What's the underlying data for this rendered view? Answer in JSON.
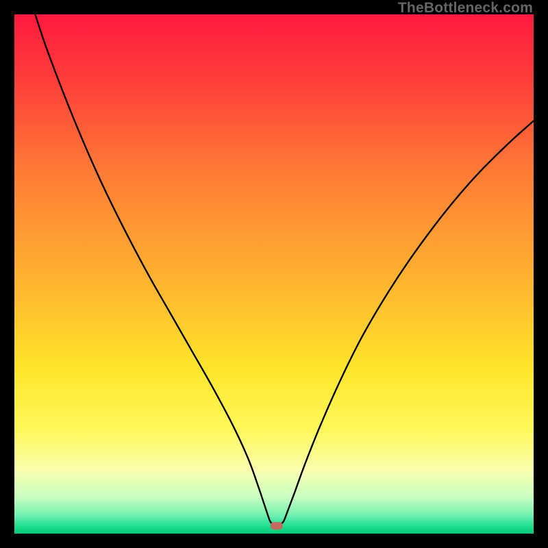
{
  "watermark": "TheBottleneck.com",
  "chart_data": {
    "type": "line",
    "title": "",
    "xlabel": "",
    "ylabel": "",
    "xlim": [
      0,
      100
    ],
    "ylim": [
      0,
      100
    ],
    "marker": {
      "x": 50.5,
      "y": 1.5,
      "color": "#c46a5f"
    },
    "background_gradient": {
      "stops": [
        {
          "offset": 0.0,
          "color": "#ff1a3f"
        },
        {
          "offset": 0.12,
          "color": "#ff3b3a"
        },
        {
          "offset": 0.3,
          "color": "#ff7a35"
        },
        {
          "offset": 0.5,
          "color": "#ffb030"
        },
        {
          "offset": 0.68,
          "color": "#ffe42a"
        },
        {
          "offset": 0.8,
          "color": "#fff85a"
        },
        {
          "offset": 0.88,
          "color": "#f7ffb0"
        },
        {
          "offset": 0.93,
          "color": "#c8ffc0"
        },
        {
          "offset": 0.965,
          "color": "#70f0b0"
        },
        {
          "offset": 0.985,
          "color": "#20e090"
        },
        {
          "offset": 1.0,
          "color": "#05c878"
        }
      ]
    },
    "series": [
      {
        "name": "bottleneck-curve",
        "type": "line",
        "color": "#000000",
        "points": [
          {
            "x": 4.0,
            "y": 100.0
          },
          {
            "x": 6.0,
            "y": 94.0
          },
          {
            "x": 9.0,
            "y": 86.0
          },
          {
            "x": 12.0,
            "y": 78.5
          },
          {
            "x": 15.0,
            "y": 71.5
          },
          {
            "x": 18.0,
            "y": 65.0
          },
          {
            "x": 22.0,
            "y": 57.0
          },
          {
            "x": 26.0,
            "y": 49.5
          },
          {
            "x": 30.0,
            "y": 42.5
          },
          {
            "x": 34.0,
            "y": 35.5
          },
          {
            "x": 38.0,
            "y": 28.5
          },
          {
            "x": 42.0,
            "y": 21.0
          },
          {
            "x": 45.0,
            "y": 14.5
          },
          {
            "x": 47.0,
            "y": 9.0
          },
          {
            "x": 48.5,
            "y": 4.5
          },
          {
            "x": 49.3,
            "y": 2.3
          },
          {
            "x": 50.0,
            "y": 1.8
          },
          {
            "x": 51.0,
            "y": 1.8
          },
          {
            "x": 51.8,
            "y": 2.3
          },
          {
            "x": 52.5,
            "y": 4.0
          },
          {
            "x": 54.0,
            "y": 8.0
          },
          {
            "x": 56.0,
            "y": 13.5
          },
          {
            "x": 59.0,
            "y": 21.0
          },
          {
            "x": 63.0,
            "y": 30.0
          },
          {
            "x": 67.0,
            "y": 38.0
          },
          {
            "x": 72.0,
            "y": 46.5
          },
          {
            "x": 77.0,
            "y": 54.0
          },
          {
            "x": 83.0,
            "y": 62.0
          },
          {
            "x": 89.0,
            "y": 69.0
          },
          {
            "x": 95.0,
            "y": 75.0
          },
          {
            "x": 100.0,
            "y": 79.5
          }
        ]
      }
    ]
  }
}
